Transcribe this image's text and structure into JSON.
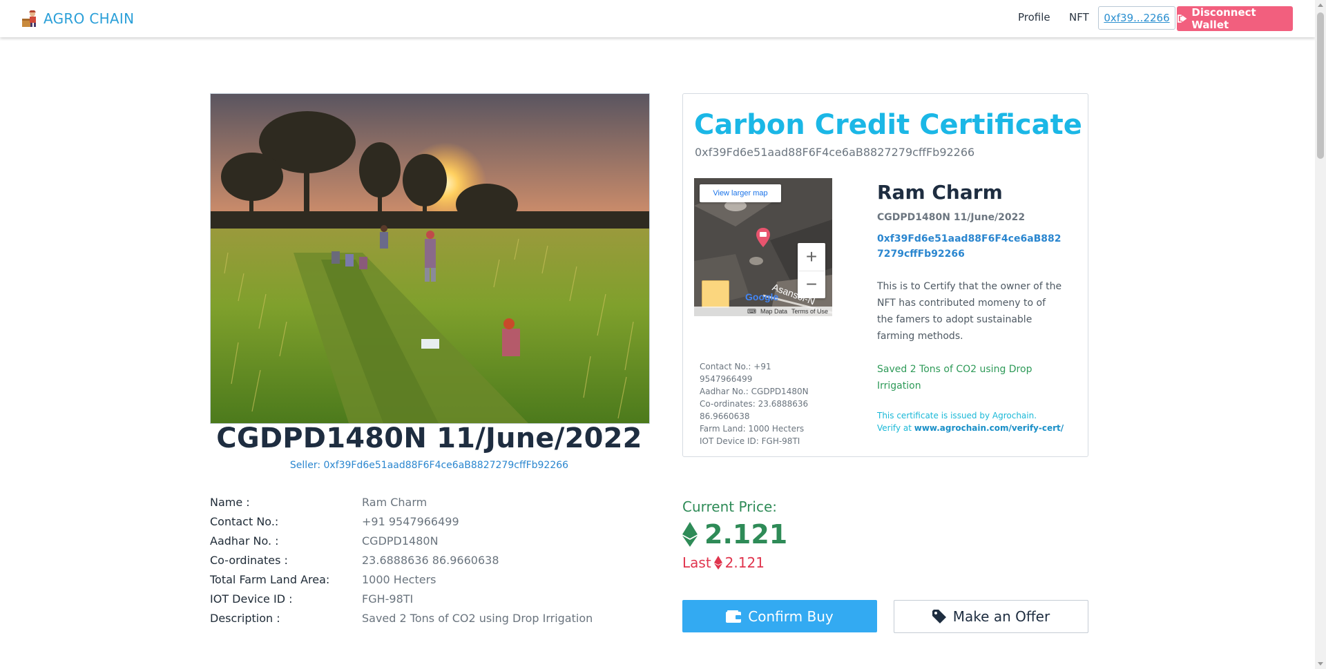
{
  "nav": {
    "brand": "AGRO CHAIN",
    "profile": "Profile",
    "nft": "NFT",
    "wallet_short": "0xf39...2266",
    "disconnect": "Disconnect Wallet"
  },
  "listing": {
    "title": "CGDPD1480N 11/June/2022",
    "seller_prefix": "Seller: ",
    "seller_address": "0xf39Fd6e51aad88F6F4ce6aB8827279cffFb92266"
  },
  "details": [
    {
      "label": "Name :",
      "value": "Ram Charm"
    },
    {
      "label": "Contact No.:",
      "value": "+91 9547966499"
    },
    {
      "label": "Aadhar No. :",
      "value": "CGDPD1480N"
    },
    {
      "label": "Co-ordinates :",
      "value": "23.6888636 86.9660638"
    },
    {
      "label": "Total Farm Land Area:",
      "value": "1000 Hecters"
    },
    {
      "label": "IOT Device ID :",
      "value": "FGH-98TI"
    },
    {
      "label": "Description :",
      "value": "Saved 2 Tons of CO2 using Drop Irrigation"
    }
  ],
  "certificate": {
    "title": "Carbon Credit Certificate",
    "address": "0xf39Fd6e51aad88F6F4ce6aB8827279cffFb92266",
    "map": {
      "view_larger": "View larger map",
      "zoom_in": "+",
      "zoom_out": "−",
      "google": "Google",
      "road_label": "Asansol-N",
      "map_data": "Map Data",
      "terms": "Terms of Use"
    },
    "info": {
      "contact": "Contact No.: +91 9547966499",
      "aadhar": "Aadhar No.: CGDPD1480N",
      "coords": "Co-ordinates: 23.6888636 86.9660638",
      "farm_land": "Farm Land: 1000 Hecters",
      "iot": "IOT Device ID: FGH-98TI"
    },
    "owner_name": "Ram Charm",
    "owner_token": "CGDPD1480N 11/June/2022",
    "owner_address": "0xf39Fd6e51aad88F6F4ce6aB8827279cffFb92266",
    "body": "This is to Certify that the owner of the NFT has contributed momeny to of the famers to adopt sustainable farming methods.",
    "saved": "Saved 2 Tons of CO2 using Drop Irrigation",
    "issued_text": "This certificate is issued by Agrochain.",
    "verify_prefix": "Verify at ",
    "verify_link": "www.agrochain.com/verify-cert/"
  },
  "price": {
    "label": "Current Price:",
    "value": "2.121",
    "last_label": "Last",
    "last_value": "2.121"
  },
  "actions": {
    "confirm": "Confirm Buy",
    "offer": "Make an Offer"
  },
  "colors": {
    "brand": "#2a9fd8",
    "disconnect": "#f25f7e",
    "cert_title": "#1bb7e6",
    "price": "#2e8b57",
    "last_price": "#e0344d",
    "confirm": "#33aaf2"
  }
}
